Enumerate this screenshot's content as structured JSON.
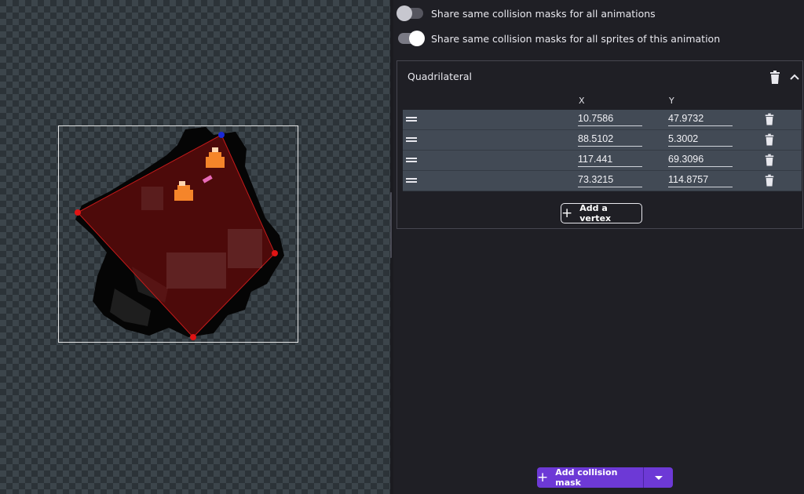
{
  "toggles": [
    {
      "label": "Share same collision masks for all animations",
      "state": "off"
    },
    {
      "label": "Share same collision masks for all sprites of this animation",
      "state": "on"
    }
  ],
  "mask": {
    "title": "Quadrilateral",
    "x_header": "X",
    "y_header": "Y",
    "vertices": [
      {
        "x": "10.7586",
        "y": "47.9732"
      },
      {
        "x": "88.5102",
        "y": "5.3002"
      },
      {
        "x": "117.441",
        "y": "69.3096"
      },
      {
        "x": "73.3215",
        "y": "114.8757"
      }
    ],
    "add_vertex_label": "Add a vertex"
  },
  "add_collision_mask_label": "Add collision mask",
  "colors": {
    "accent": "#6d39d6",
    "polygon_fill": "#7a0f0f",
    "vertex": "#e01414",
    "origin_vertex": "#1a2ad8"
  },
  "icons": {
    "mask_delete": "trash-icon",
    "mask_collapse": "chevron-up-icon",
    "row_delete": "trash-icon",
    "drag": "drag-handle-icon",
    "add": "plus-icon",
    "dropdown": "caret-down-icon"
  }
}
